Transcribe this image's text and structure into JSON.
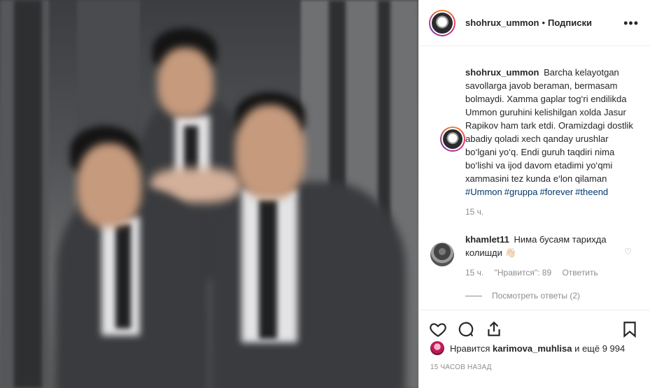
{
  "post": {
    "username": "shohrux_ummon",
    "separator": "•",
    "follow_label": "Подписки",
    "more_label": "•••"
  },
  "caption": {
    "username": "shohrux_ummon",
    "text": "Barcha kelayotgan savollarga javob beraman, bermasam bolmaydi. Xamma gaplar tog‘ri endilikda Ummon guruhini kelishilgan xolda Jasur Rapikov ham tark etdi. Oramizdagi dostlik abadiy qoladi xech qanday urushlar bo‘lgani yo‘q. Endi guruh taqdiri nima bo‘lishi va ijod davom etadimi yo‘qmi xammasini tez kunda e‘lon qilaman",
    "hashtags": [
      "#Ummon",
      "#gruppa",
      "#forever",
      "#theend"
    ],
    "time": "15 ч."
  },
  "comment": {
    "username": "khamlet11",
    "text": "Нима бусаям тарихда колишди 👋🏻",
    "time": "15 ч.",
    "likes": "\"Нравится\": 89",
    "reply_label": "Ответить",
    "view_replies": "Посмотреть ответы (2)"
  },
  "likes": {
    "prefix": "Нравится",
    "user": "karimova_muhlisa",
    "suffix": "и ещё 9 994"
  },
  "timestamp": "15 ЧАСОВ НАЗАД",
  "icons": [
    "heart-icon",
    "comment-icon",
    "share-icon",
    "bookmark-icon",
    "more-icon"
  ]
}
